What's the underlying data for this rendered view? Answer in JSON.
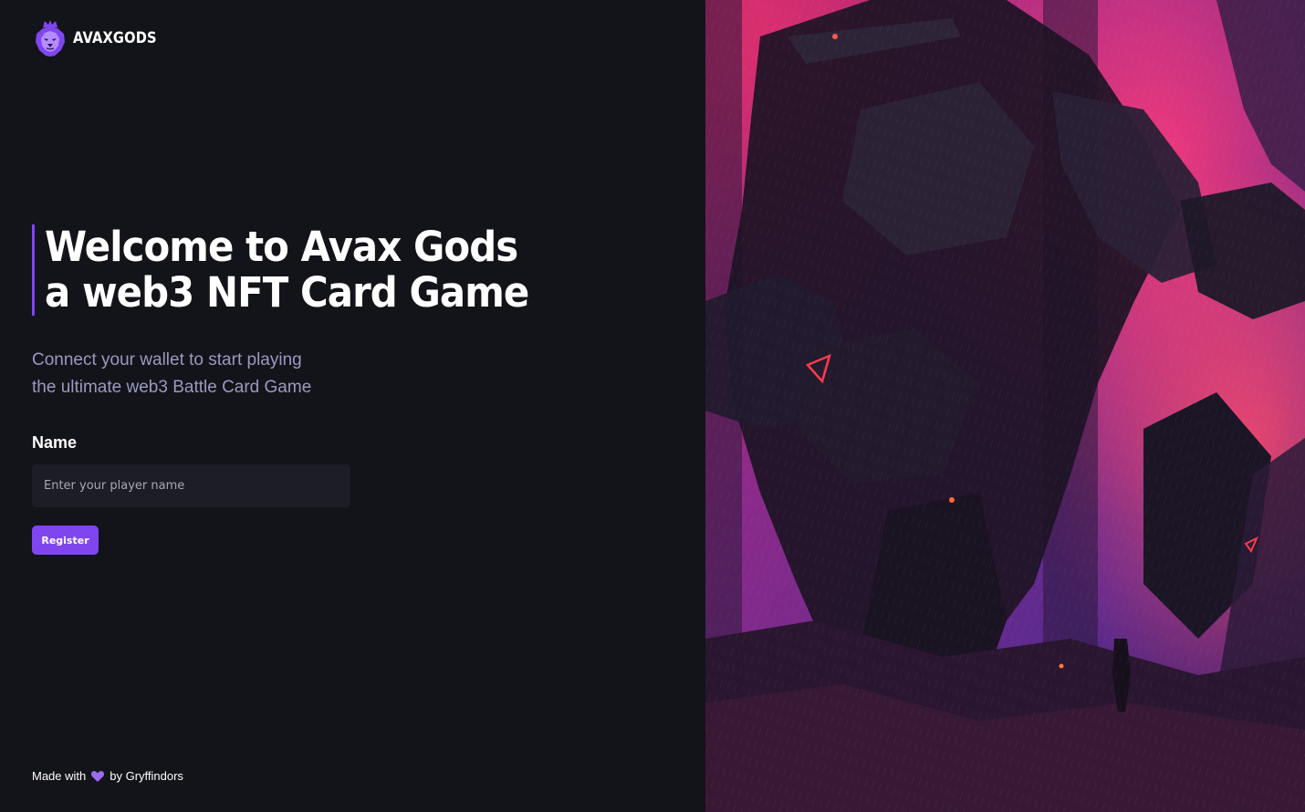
{
  "brand": {
    "name": "AVAXGODS",
    "accent": "#7f46f0"
  },
  "hero": {
    "line1": "Welcome to Avax Gods",
    "line2": "a web3 NFT Card Game"
  },
  "subtitle": {
    "line1": "Connect your wallet to start playing",
    "line2": "the ultimate web3 Battle Card Game"
  },
  "form": {
    "name_label": "Name",
    "name_placeholder": "Enter your player name",
    "name_value": "",
    "register_label": "Register"
  },
  "footer": {
    "made_with": "Made with",
    "heart_icon": "purple-heart-icon",
    "by": "by Gryffindors"
  },
  "colors": {
    "background": "#13131a",
    "input_bg": "#1d1d26",
    "subtitle": "#9a9ac0",
    "art_pink": "#e0306e",
    "art_purple": "#5a2a8a"
  }
}
